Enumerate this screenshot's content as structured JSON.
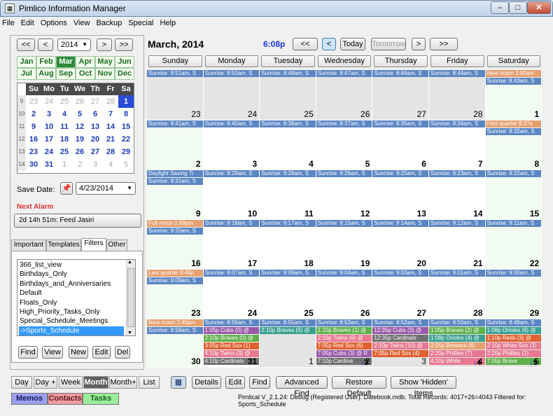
{
  "window": {
    "title": "Pimlico Information Manager",
    "min": "–",
    "max": "□",
    "close": "✕"
  },
  "menu": [
    "File",
    "Edit",
    "Options",
    "View",
    "Backup",
    "Special",
    "Help"
  ],
  "left": {
    "nav": {
      "prev2": "<<",
      "prev": "<",
      "year": "2014",
      "next": ">",
      "next2": ">>"
    },
    "months": [
      "Jan",
      "Feb",
      "Mar",
      "Apr",
      "May",
      "Jun",
      "Jul",
      "Aug",
      "Sep",
      "Oct",
      "Nov",
      "Dec"
    ],
    "selected_month": "Mar",
    "mini": {
      "headers": [
        "Su",
        "Mo",
        "Tu",
        "We",
        "Th",
        "Fr",
        "Sa"
      ],
      "weeks": [
        {
          "wk": "9",
          "days": [
            [
              "23",
              1
            ],
            [
              "24",
              1
            ],
            [
              "25",
              1
            ],
            [
              "26",
              1
            ],
            [
              "27",
              1
            ],
            [
              "28",
              1
            ],
            [
              "1",
              0
            ]
          ]
        },
        {
          "wk": "10",
          "days": [
            [
              "2",
              0
            ],
            [
              "3",
              0
            ],
            [
              "4",
              0
            ],
            [
              "5",
              0
            ],
            [
              "6",
              0
            ],
            [
              "7",
              0
            ],
            [
              "8",
              0
            ]
          ]
        },
        {
          "wk": "11",
          "days": [
            [
              "9",
              0
            ],
            [
              "10",
              0
            ],
            [
              "11",
              0
            ],
            [
              "12",
              0
            ],
            [
              "13",
              0
            ],
            [
              "14",
              0
            ],
            [
              "15",
              0
            ]
          ]
        },
        {
          "wk": "12",
          "days": [
            [
              "16",
              0
            ],
            [
              "17",
              0
            ],
            [
              "18",
              0
            ],
            [
              "19",
              0
            ],
            [
              "20",
              0
            ],
            [
              "21",
              0
            ],
            [
              "22",
              0
            ]
          ]
        },
        {
          "wk": "13",
          "days": [
            [
              "23",
              0
            ],
            [
              "24",
              0
            ],
            [
              "25",
              0
            ],
            [
              "26",
              0
            ],
            [
              "27",
              0
            ],
            [
              "28",
              0
            ],
            [
              "29",
              0
            ]
          ]
        },
        {
          "wk": "14",
          "days": [
            [
              "30",
              0
            ],
            [
              "31",
              0
            ],
            [
              "1",
              1
            ],
            [
              "2",
              1
            ],
            [
              "3",
              1
            ],
            [
              "4",
              1
            ],
            [
              "5",
              1
            ]
          ]
        }
      ]
    },
    "save_date_label": "Save Date:",
    "save_date_value": "4/23/2014",
    "next_alarm_label": "Next Alarm",
    "next_alarm_value": "2d 14h 51m:  Feed Jasiri",
    "tabs": [
      "Important",
      "Templates",
      "Filters",
      "Other"
    ],
    "active_tab": "Filters",
    "filters": [
      "366_list_view",
      "Birthdays_Only",
      "Birthdays_and_Anniversaries",
      "Default",
      "Floats_Only",
      "High_Priority_Tasks_Only",
      "Special_Schedule_Meetings",
      "->Sports_Schedule"
    ],
    "selected_filter": "->Sports_Schedule",
    "buttons": [
      "Find",
      "View",
      "New",
      "Edit",
      "Del"
    ]
  },
  "header": {
    "month_title": "March, 2014",
    "time": "6:08p",
    "prev2": "<<",
    "prev": "<",
    "today": "Today",
    "tomorrow": "Tomorrow",
    "next": ">",
    "next2": ">>"
  },
  "calendar": {
    "day_headers": [
      "Sunday",
      "Monday",
      "Tuesday",
      "Wednesday",
      "Thursday",
      "Friday",
      "Saturday"
    ],
    "weeks": [
      [
        {
          "d": "23",
          "cur": 0,
          "items": [
            [
              "sun",
              "Sunrise: 8:51am, S"
            ]
          ]
        },
        {
          "d": "24",
          "cur": 0,
          "items": [
            [
              "sun",
              "Sunrise: 8:50am, S"
            ]
          ]
        },
        {
          "d": "25",
          "cur": 0,
          "items": [
            [
              "sun",
              "Sunrise: 8:48am, S"
            ]
          ]
        },
        {
          "d": "26",
          "cur": 0,
          "items": [
            [
              "sun",
              "Sunrise: 8:47am, S"
            ]
          ]
        },
        {
          "d": "27",
          "cur": 0,
          "items": [
            [
              "sun",
              "Sunrise: 8:46am, S"
            ]
          ]
        },
        {
          "d": "28",
          "cur": 0,
          "items": [
            [
              "sun",
              "Sunrise: 8:44am, S"
            ]
          ]
        },
        {
          "d": "1",
          "cur": 1,
          "items": [
            [
              "orange",
              "New moon 3:00am"
            ],
            [
              "sun",
              "Sunrise: 8:43am, S"
            ]
          ]
        }
      ],
      [
        {
          "d": "2",
          "cur": 1,
          "items": [
            [
              "sun",
              "Sunrise: 8:41am, S"
            ]
          ]
        },
        {
          "d": "3",
          "cur": 1,
          "items": [
            [
              "sun",
              "Sunrise: 8:40am, S"
            ]
          ]
        },
        {
          "d": "4",
          "cur": 1,
          "items": [
            [
              "sun",
              "Sunrise: 8:38am, S"
            ]
          ]
        },
        {
          "d": "5",
          "cur": 1,
          "items": [
            [
              "sun",
              "Sunrise: 8:37am, S"
            ]
          ]
        },
        {
          "d": "6",
          "cur": 1,
          "items": [
            [
              "sun",
              "Sunrise: 8:35am, S"
            ]
          ]
        },
        {
          "d": "7",
          "cur": 1,
          "items": [
            [
              "sun",
              "Sunrise: 8:34am, S"
            ]
          ]
        },
        {
          "d": "8",
          "cur": 1,
          "items": [
            [
              "orange",
              "First quarter 8:27a"
            ],
            [
              "sun",
              "Sunrise: 8:32am, S"
            ]
          ]
        }
      ],
      [
        {
          "d": "9",
          "cur": 1,
          "items": [
            [
              "sun",
              "Daylight Saving Ti"
            ],
            [
              "sun",
              "Sunrise: 9:31am, S"
            ]
          ]
        },
        {
          "d": "10",
          "cur": 1,
          "items": [
            [
              "sun",
              "Sunrise: 9:29am, S"
            ]
          ]
        },
        {
          "d": "11",
          "cur": 1,
          "items": [
            [
              "sun",
              "Sunrise: 9:28am, S"
            ]
          ]
        },
        {
          "d": "12",
          "cur": 1,
          "items": [
            [
              "sun",
              "Sunrise: 9:26am, S"
            ]
          ]
        },
        {
          "d": "13",
          "cur": 1,
          "items": [
            [
              "sun",
              "Sunrise: 9:25am, S"
            ]
          ]
        },
        {
          "d": "14",
          "cur": 1,
          "items": [
            [
              "sun",
              "Sunrise: 9:23am, S"
            ]
          ]
        },
        {
          "d": "15",
          "cur": 1,
          "items": [
            [
              "sun",
              "Sunrise: 9:22am, S"
            ]
          ]
        }
      ],
      [
        {
          "d": "16",
          "cur": 1,
          "items": [
            [
              "orange",
              "Full moon 1:09pm"
            ],
            [
              "sun",
              "Sunrise: 9:20am, S"
            ]
          ]
        },
        {
          "d": "17",
          "cur": 1,
          "items": [
            [
              "sun",
              "Sunrise: 9:18am, S"
            ]
          ]
        },
        {
          "d": "18",
          "cur": 1,
          "items": [
            [
              "sun",
              "Sunrise: 9:17am, S"
            ]
          ]
        },
        {
          "d": "19",
          "cur": 1,
          "items": [
            [
              "sun",
              "Sunrise: 9:15am, S"
            ]
          ]
        },
        {
          "d": "20",
          "cur": 1,
          "items": [
            [
              "sun",
              "Sunrise: 9:14am, S"
            ]
          ]
        },
        {
          "d": "21",
          "cur": 1,
          "items": [
            [
              "sun",
              "Sunrise: 9:12am, S"
            ]
          ]
        },
        {
          "d": "22",
          "cur": 1,
          "items": [
            [
              "sun",
              "Sunrise: 9:11am, S"
            ]
          ]
        }
      ],
      [
        {
          "d": "23",
          "cur": 1,
          "items": [
            [
              "orange",
              "Last quarter 9:46p"
            ],
            [
              "sun",
              "Sunrise: 9:09am, S"
            ]
          ]
        },
        {
          "d": "24",
          "cur": 1,
          "items": [
            [
              "sun",
              "Sunrise: 9:07am, S"
            ]
          ]
        },
        {
          "d": "25",
          "cur": 1,
          "items": [
            [
              "sun",
              "Sunrise: 9:06am, S"
            ]
          ]
        },
        {
          "d": "26",
          "cur": 1,
          "items": [
            [
              "sun",
              "Sunrise: 9:04am, S"
            ]
          ]
        },
        {
          "d": "27",
          "cur": 1,
          "items": [
            [
              "sun",
              "Sunrise: 9:03am, S"
            ]
          ]
        },
        {
          "d": "28",
          "cur": 1,
          "items": [
            [
              "sun",
              "Sunrise: 9:01am, S"
            ]
          ]
        },
        {
          "d": "29",
          "cur": 1,
          "items": [
            [
              "sun",
              "Sunrise: 9:00am, S"
            ]
          ]
        }
      ],
      [
        {
          "d": "30",
          "cur": 1,
          "items": [
            [
              "orange",
              "New moon 2:45pm"
            ],
            [
              "sun",
              "Sunrise: 8:58am, S"
            ]
          ]
        },
        {
          "d": "31",
          "cur": 1,
          "items": [
            [
              "sun",
              "Sunrise: 8:56am, S"
            ],
            [
              "purple",
              "1:05p Cubs (0) @"
            ],
            [
              "green",
              "2:10p Braves (0) @"
            ],
            [
              "red",
              "3:05p Red Sox (1)"
            ],
            [
              "pink",
              "4:10p Twins (3) @"
            ],
            [
              "dk",
              "4:10p Cardinals"
            ]
          ]
        },
        {
          "d": "1",
          "cur": 0,
          "items": [
            [
              "sun",
              "Sunrise: 8:55am, S"
            ],
            [
              "teal",
              "2:10p Braves (5) @"
            ]
          ]
        },
        {
          "d": "2",
          "cur": 0,
          "items": [
            [
              "sun",
              "Sunrise: 8:53am, S"
            ],
            [
              "green",
              "1:10p Braves (1) @"
            ],
            [
              "pink",
              "2:10p Twins (6) @"
            ],
            [
              "red",
              "7:05p Red Sox (6)"
            ],
            [
              "purple",
              "7:05p Cubs (3) @ R"
            ],
            [
              "dk",
              "7:10p Cardina"
            ]
          ]
        },
        {
          "d": "3",
          "cur": 0,
          "items": [
            [
              "sun",
              "Sunrise: 8:52am, S"
            ],
            [
              "purple",
              "12:35p Cubs (3) @"
            ],
            [
              "dk",
              "12:35p Cardinals"
            ],
            [
              "pink",
              "2:10p Twins (10) @"
            ],
            [
              "red",
              "7:05p Red Sox (4)"
            ]
          ]
        },
        {
          "d": "4",
          "cur": 0,
          "items": [
            [
              "sun",
              "Sunrise: 8:50am, S"
            ],
            [
              "green",
              "1:05p Braves (2) @"
            ],
            [
              "teal",
              "1:08p Orioles (4) @"
            ],
            [
              "orange",
              "2:05p Brewers (6)"
            ],
            [
              "pink",
              "2:20p Phillies (7)"
            ],
            [
              "pink",
              "4:10p White"
            ]
          ]
        },
        {
          "d": "5",
          "cur": 0,
          "items": [
            [
              "sun",
              "Sunrise: 8:49am, S"
            ],
            [
              "teal",
              "1:08p Orioles (6) @"
            ],
            [
              "red",
              "1:10p Reds (3) @"
            ],
            [
              "pink",
              "2:10p White Sox (3)"
            ],
            [
              "pink",
              "2:20p Phillies (2)"
            ],
            [
              "green",
              "7:05p Brave"
            ]
          ]
        }
      ]
    ],
    "overflow": [
      "3",
      "4",
      "5"
    ]
  },
  "bottom": {
    "views": [
      "Day",
      "Day +",
      "Week",
      "Month",
      "Month+",
      "List"
    ],
    "active_view": "Month",
    "actions": [
      "Details",
      "Edit",
      "Find",
      "Advanced Find",
      "Restore Default",
      "Show 'Hidden' Items"
    ],
    "modules": [
      "Memos",
      "Contacts",
      "Tasks"
    ],
    "status": "Pimlical V_2.1.24: Debug (Registered User). Datebook.mdb. Total Records: 4017+26=4043 Filtered for: Sports_Schedule"
  }
}
